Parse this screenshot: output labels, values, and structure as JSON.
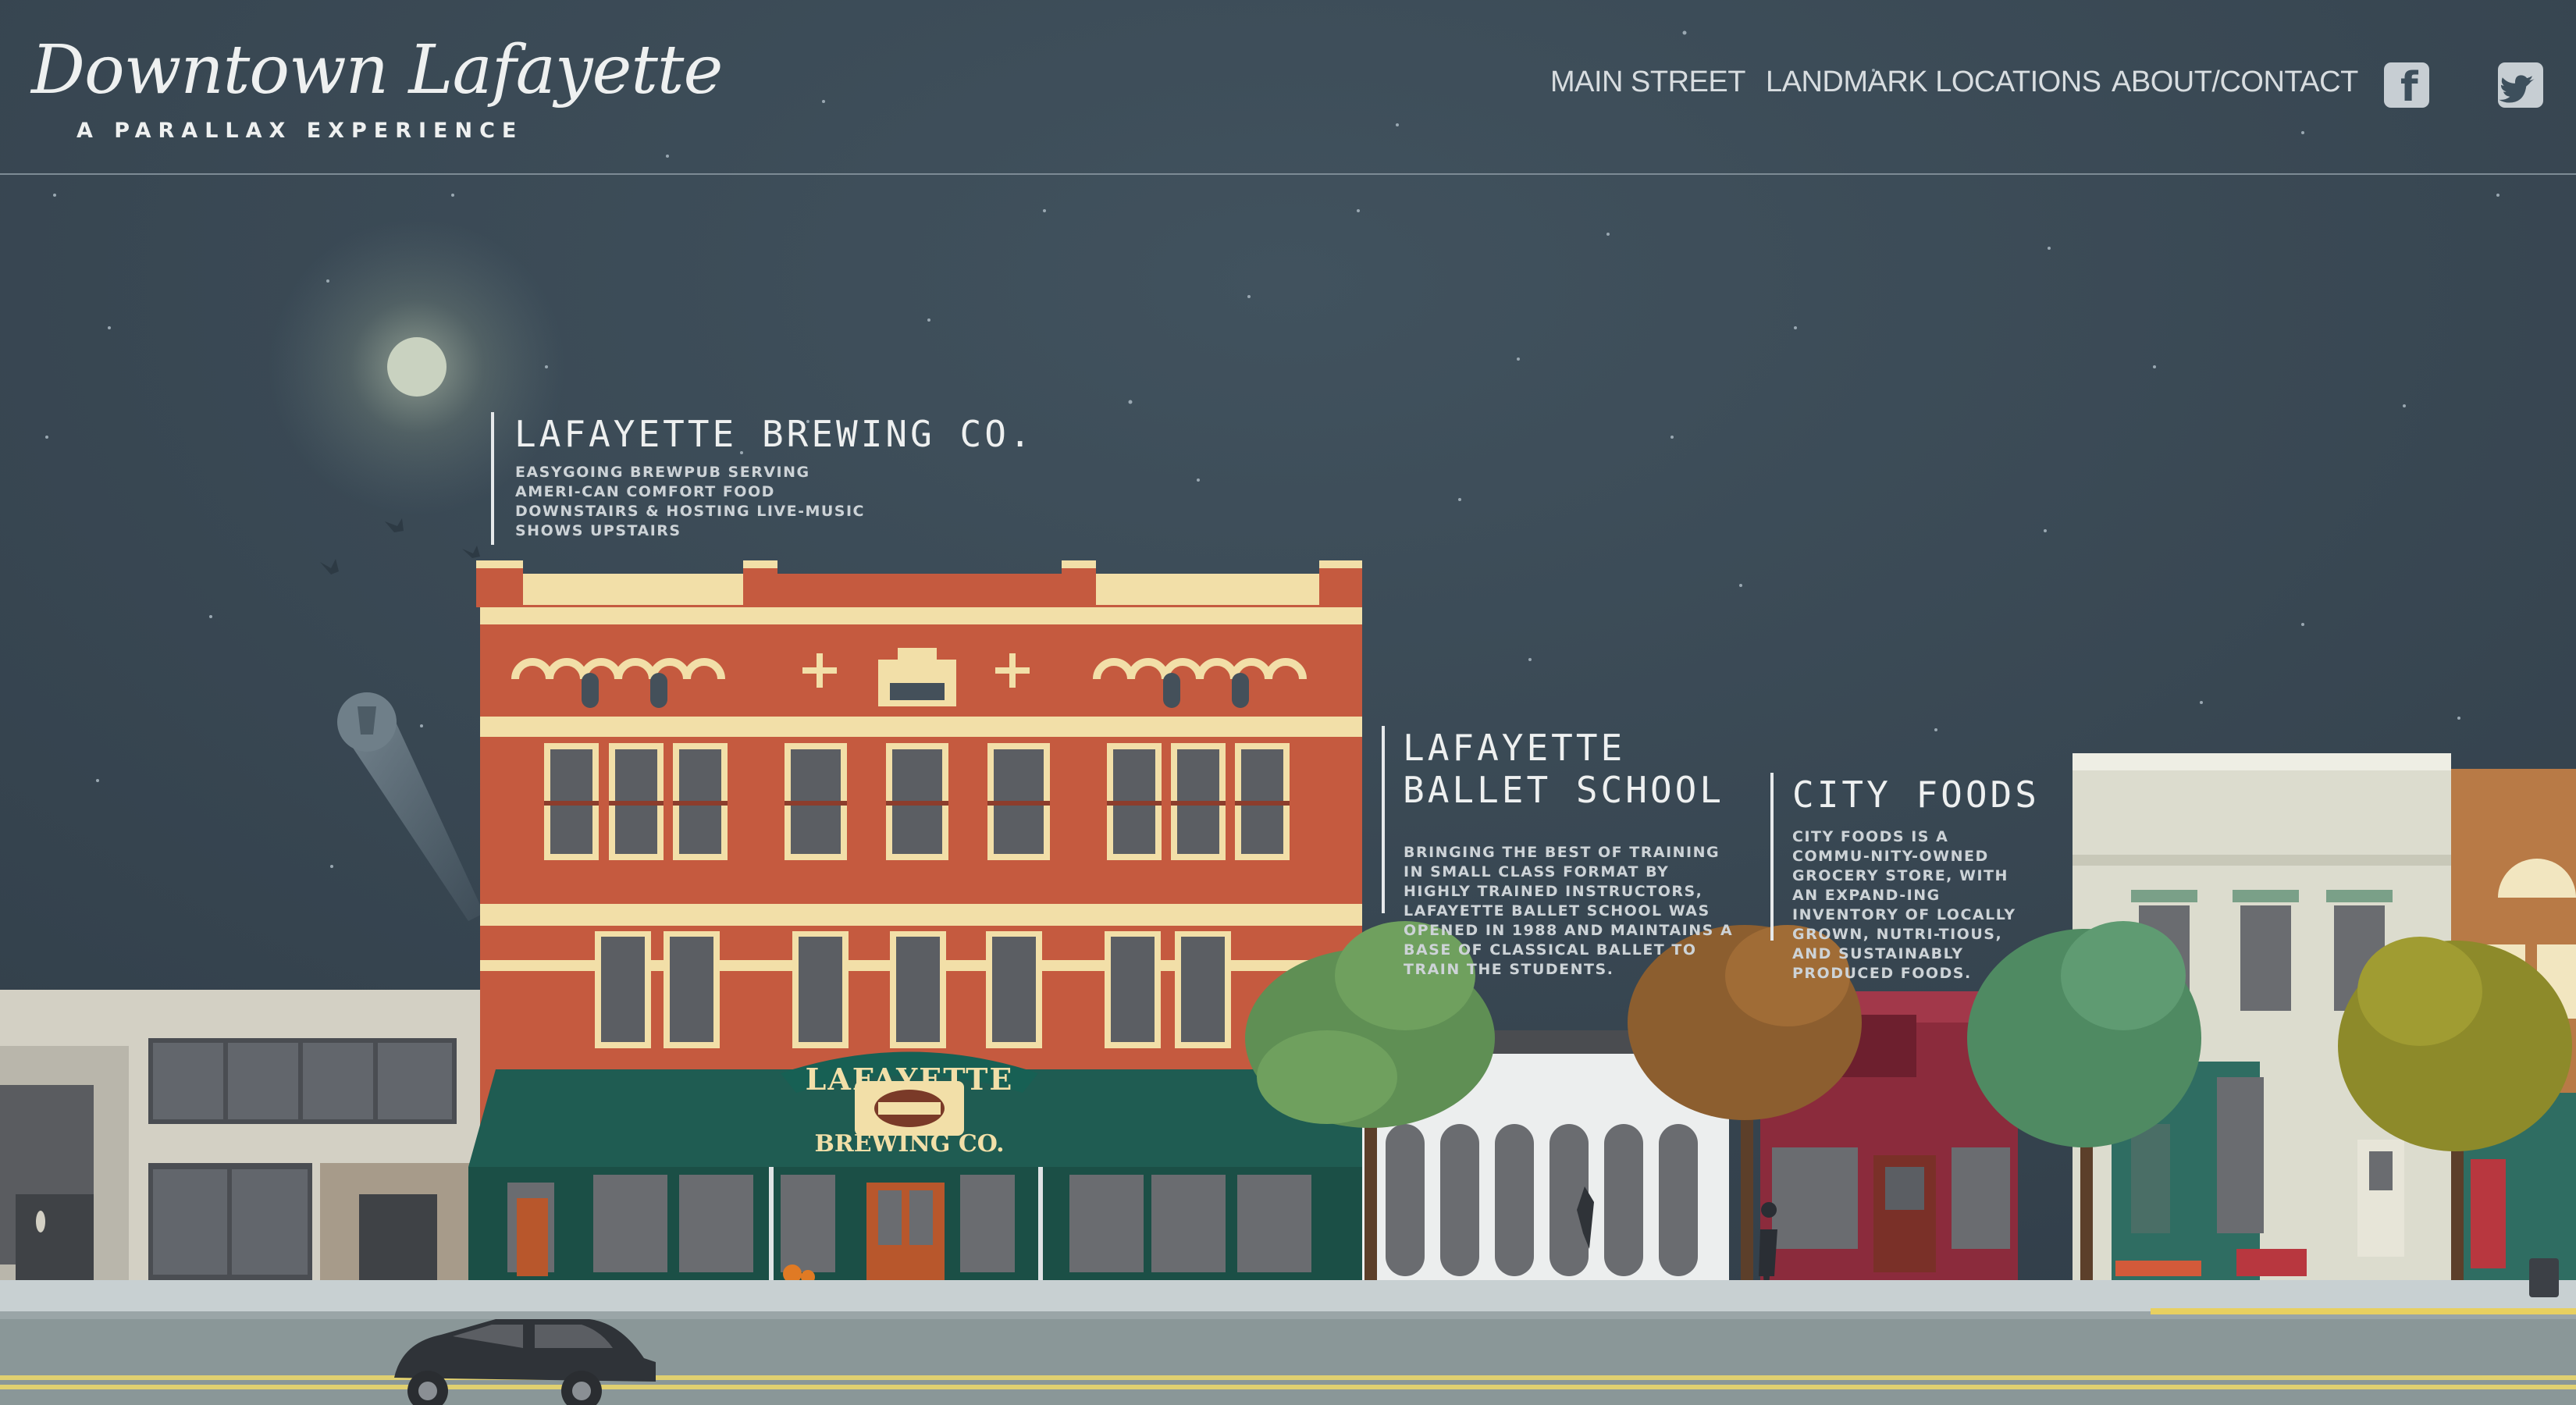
{
  "logo": {
    "script_text": "Downtown Lafayette",
    "subtitle": "A PARALLAX EXPERIENCE"
  },
  "nav": {
    "items": [
      {
        "label": "MAIN STREET"
      },
      {
        "label": "LANDMARK LOCATIONS"
      },
      {
        "label": "ABOUT/CONTACT"
      }
    ],
    "social": [
      {
        "icon": "facebook-icon",
        "glyph": "f"
      },
      {
        "icon": "twitter-icon",
        "glyph": "t"
      }
    ]
  },
  "landmarks": [
    {
      "title_lines": [
        "LAFAYETTE BREWING CO."
      ],
      "description": "EASYGOING BREWPUB SERVING AMERI-CAN COMFORT FOOD DOWNSTAIRS & HOSTING LIVE-MUSIC SHOWS UPSTAIRS"
    },
    {
      "title_lines": [
        "LAFAYETTE",
        "BALLET SCHOOL"
      ],
      "description": "BRINGING THE BEST OF TRAINING IN SMALL CLASS FORMAT BY HIGHLY TRAINED INSTRUCTORS, LAFAYETTE BALLET SCHOOL WAS OPENED IN 1988 AND MAINTAINS A BASE OF CLASSICAL BALLET TO TRAIN THE STUDENTS."
    },
    {
      "title_lines": [
        "CITY FOODS"
      ],
      "description": "CITY FOODS IS A COMMU-NITY-OWNED GROCERY STORE, WITH AN EXPAND-ING INVENTORY OF LOCALLY GROWN, NUTRI-TIOUS, AND SUSTAINABLY PRODUCED FOODS."
    }
  ],
  "brewery_sign": {
    "arch_text": "LAFAYETTE",
    "bottom_text": "BREWING CO."
  },
  "colors": {
    "sky": "#384a57",
    "brick": "#c55a3f",
    "cream": "#f2dfa8",
    "awning": "#1f5c52",
    "street": "#8a9798",
    "road_line": "#e8d060"
  }
}
